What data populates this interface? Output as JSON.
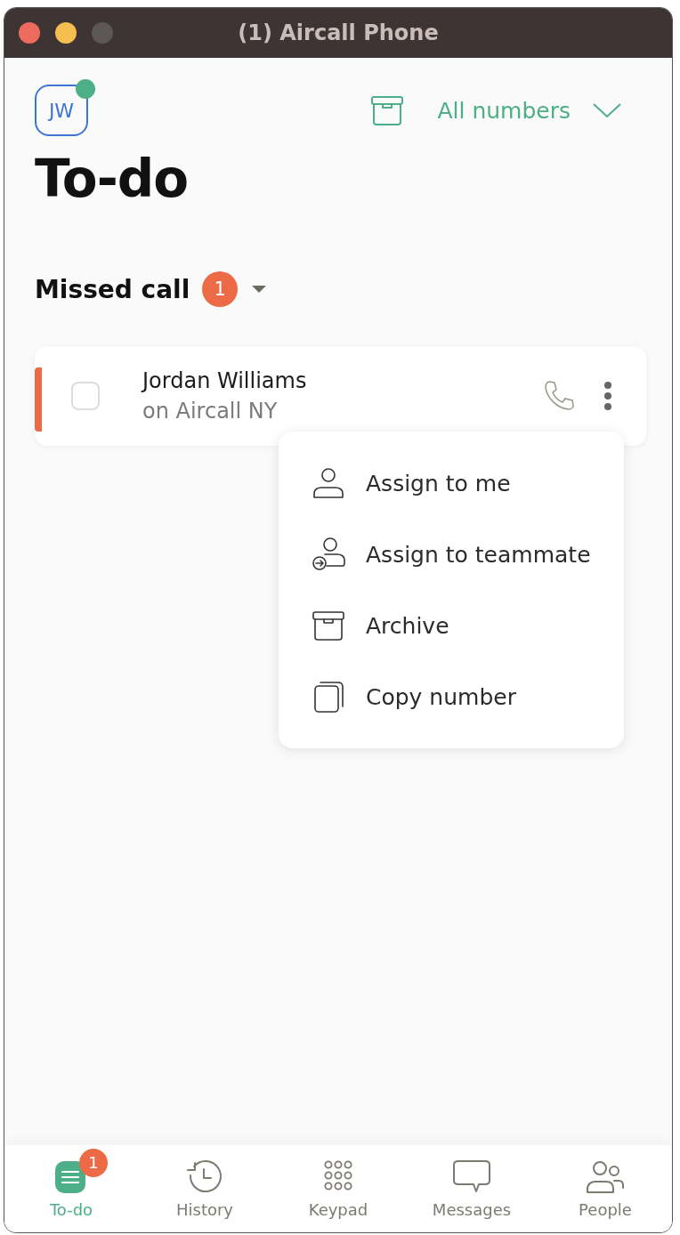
{
  "window": {
    "title": "(1) Aircall Phone"
  },
  "header": {
    "avatar": {
      "initials": "JW",
      "online": true
    },
    "number_filter": "All numbers"
  },
  "page_title": "To-do",
  "section": {
    "title": "Missed call",
    "count": "1",
    "expanded": true
  },
  "calls": [
    {
      "name": "Jordan Williams",
      "line": "on Aircall NY",
      "checked": false,
      "menu_open": true
    }
  ],
  "menu": [
    {
      "kind": "assign-me",
      "label": "Assign to me"
    },
    {
      "kind": "assign-teammate",
      "label": "Assign to teammate"
    },
    {
      "kind": "archive",
      "label": "Archive"
    },
    {
      "kind": "copy",
      "label": "Copy number"
    }
  ],
  "nav": [
    {
      "kind": "todo",
      "label": "To-do",
      "selected": true,
      "badge": "1"
    },
    {
      "kind": "history",
      "label": "History",
      "selected": false
    },
    {
      "kind": "keypad",
      "label": "Keypad",
      "selected": false
    },
    {
      "kind": "messages",
      "label": "Messages",
      "selected": false
    },
    {
      "kind": "people",
      "label": "People",
      "selected": false
    }
  ]
}
